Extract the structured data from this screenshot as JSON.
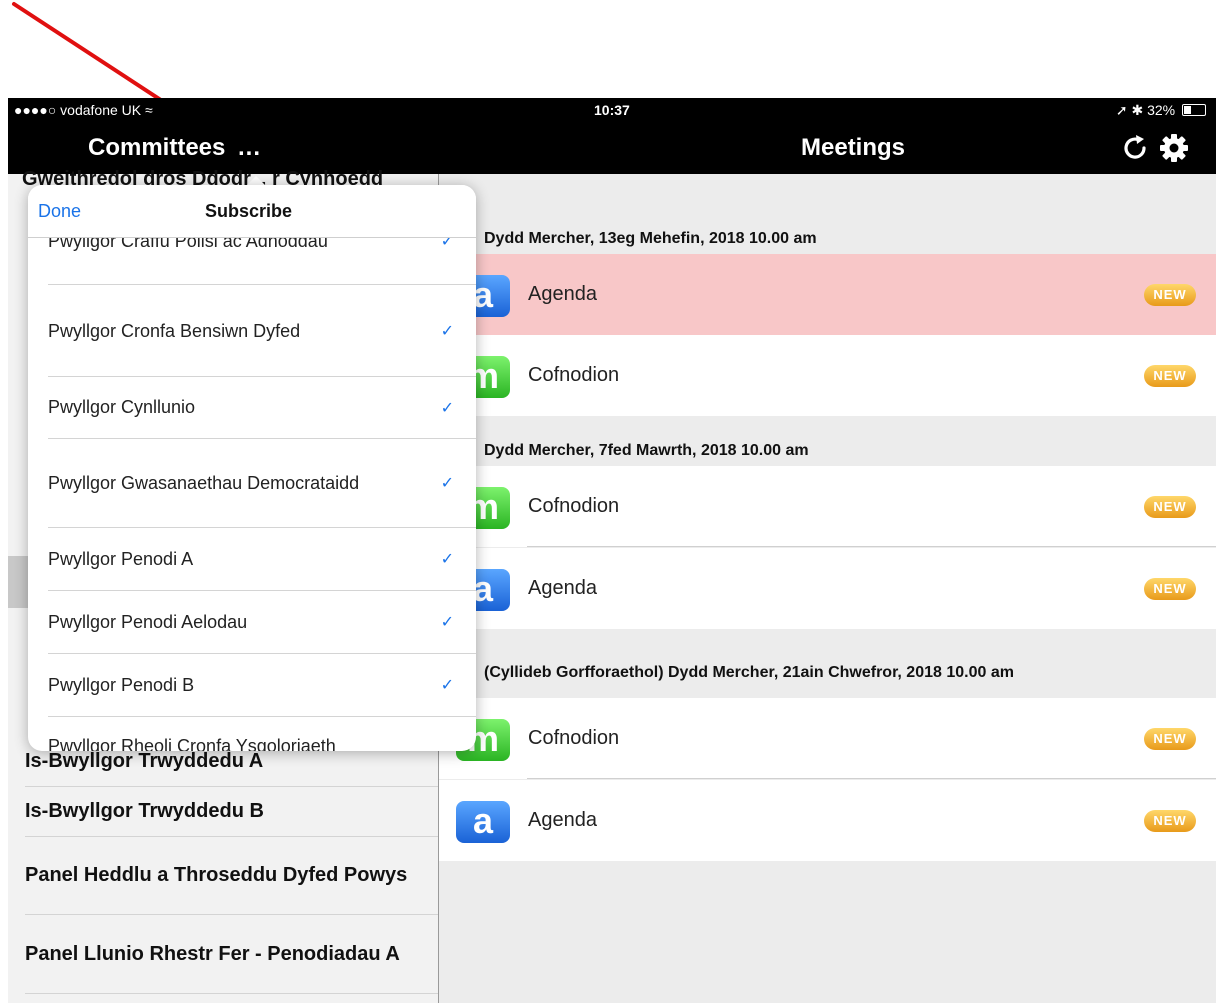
{
  "status": {
    "carrier": "●●●●○ vodafone UK",
    "time": "10:37",
    "battery": "32%"
  },
  "nav": {
    "left_title": "Committees",
    "dots": "...",
    "center_title": "Meetings"
  },
  "left_list": {
    "cut_top": "Gweithredol dros Ddodr... r Cynhoedd",
    "items": [
      "Is-Bwyllgor Trwyddedu A",
      "Is-Bwyllgor Trwyddedu B",
      "Panel Heddlu a Throseddu Dyfed Powys",
      "Panel Llunio Rhestr Fer - Penodiadau A"
    ]
  },
  "popup": {
    "done": "Done",
    "title": "Subscribe",
    "items": [
      "Pwyllgor Craffu Polisi ac Adnoddau",
      "Pwyllgor Cronfa Bensiwn Dyfed",
      "Pwyllgor Cynllunio",
      "Pwyllgor Gwasanaethau Democrataidd",
      "Pwyllgor Penodi A",
      "Pwyllgor Penodi Aelodau",
      "Pwyllgor Penodi B",
      "Pwyllgor Rheoli Cronfa Ysgoloriaeth"
    ],
    "check": "✓"
  },
  "meetings": {
    "new_label": "NEW",
    "sections": [
      {
        "heading": "Dydd Mercher, 13eg Mehefin, 2018 10.00 am",
        "rows": [
          {
            "icon": "a",
            "label": "Agenda"
          },
          {
            "icon": "m",
            "label": "Cofnodion"
          }
        ]
      },
      {
        "heading": "Dydd Mercher, 7fed Mawrth, 2018 10.00 am",
        "rows": [
          {
            "icon": "m",
            "label": "Cofnodion"
          },
          {
            "icon": "a",
            "label": "Agenda"
          }
        ]
      },
      {
        "heading": "(Cyllideb Gorfforaethol) Dydd Mercher, 21ain Chwefror, 2018 10.00 am",
        "rows": [
          {
            "icon": "m",
            "label": "Cofnodion"
          },
          {
            "icon": "a",
            "label": "Agenda"
          }
        ]
      }
    ]
  },
  "colors": {
    "highlight_row": "#f8c7c8",
    "accent": "#1a73e8",
    "arrow": "#e01010"
  }
}
